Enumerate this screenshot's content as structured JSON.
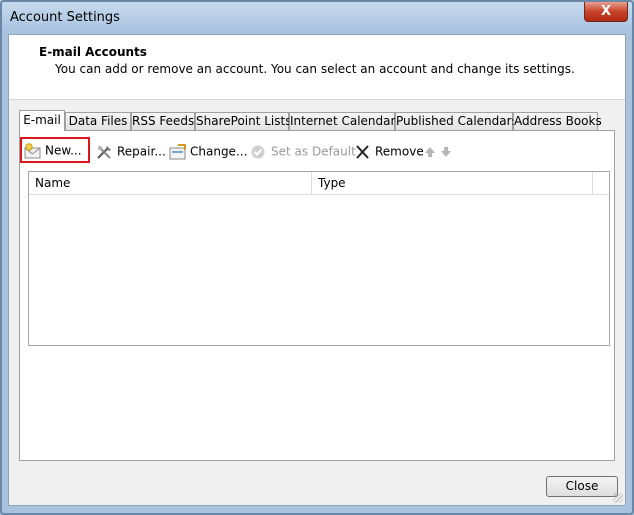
{
  "window": {
    "title": "Account Settings",
    "close_glyph": "X"
  },
  "header": {
    "title": "E-mail Accounts",
    "description": "You can add or remove an account. You can select an account and change its settings."
  },
  "tabs": [
    {
      "label": "E-mail",
      "active": true
    },
    {
      "label": "Data Files"
    },
    {
      "label": "RSS Feeds"
    },
    {
      "label": "SharePoint Lists"
    },
    {
      "label": "Internet Calendars"
    },
    {
      "label": "Published Calendars"
    },
    {
      "label": "Address Books"
    }
  ],
  "toolbar": {
    "new_label": "New...",
    "repair_label": "Repair...",
    "change_label": "Change...",
    "set_default_label": "Set as Default",
    "remove_label": "Remove"
  },
  "list": {
    "columns": [
      "Name",
      "Type"
    ],
    "rows": []
  },
  "footer": {
    "close_label": "Close"
  },
  "colors": {
    "highlight": "#e0141c",
    "window_frame": "#a9c3df",
    "close_red": "#c7432b"
  }
}
